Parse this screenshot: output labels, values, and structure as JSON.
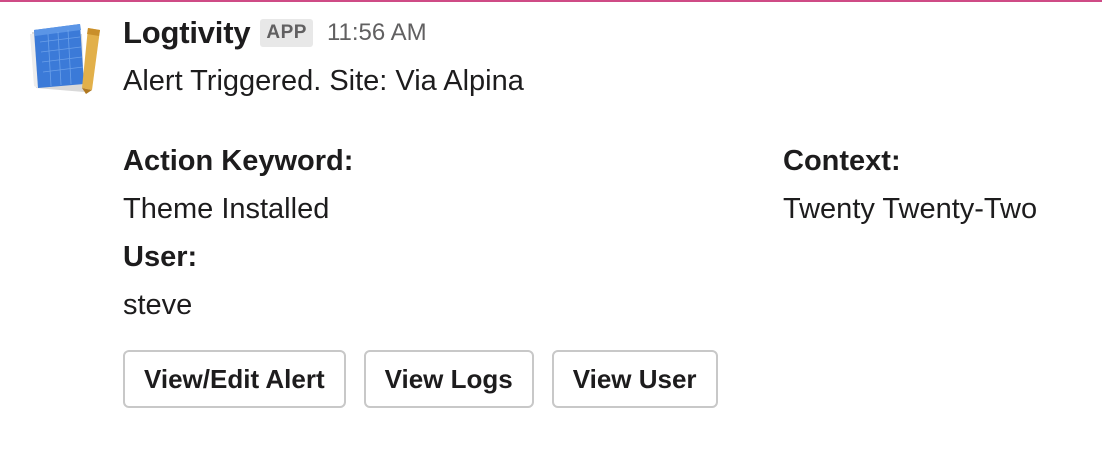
{
  "message": {
    "app_name": "Logtivity",
    "badge": "APP",
    "timestamp": "11:56 AM",
    "text": "Alert Triggered. Site: Via Alpina",
    "avatar_icon": "blueprint-book-icon"
  },
  "fields": {
    "action_keyword": {
      "label": "Action Keyword:",
      "value": "Theme Installed"
    },
    "context": {
      "label": "Context:",
      "value": "Twenty Twenty-Two"
    },
    "user": {
      "label": "User:",
      "value": "steve"
    }
  },
  "actions": {
    "view_edit_alert": "View/Edit Alert",
    "view_logs": "View Logs",
    "view_user": "View User"
  },
  "colors": {
    "accent_rule": "#cf4b86",
    "text": "#1d1c1d",
    "muted": "#616061",
    "badge_bg": "#e8e8e8",
    "button_border": "#c8c8c8"
  }
}
